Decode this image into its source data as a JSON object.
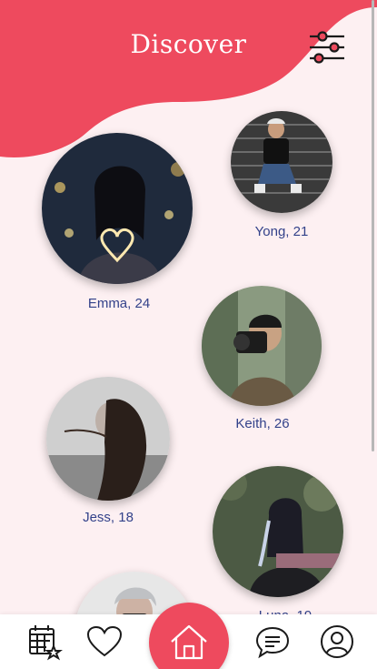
{
  "header": {
    "title": "Discover",
    "accent": "#ee4a5e"
  },
  "profiles": [
    {
      "name": "Emma, 24"
    },
    {
      "name": "Yong, 21"
    },
    {
      "name": "Keith, 26"
    },
    {
      "name": "Jess, 18"
    },
    {
      "name": "Luna, 19"
    },
    {
      "name": ""
    }
  ],
  "icons": {
    "filter": "sliders-icon",
    "calendar": "calendar-star-icon",
    "favorites": "heart-icon",
    "home": "home-icon",
    "messages": "chat-bubble-icon",
    "profile": "user-icon"
  }
}
